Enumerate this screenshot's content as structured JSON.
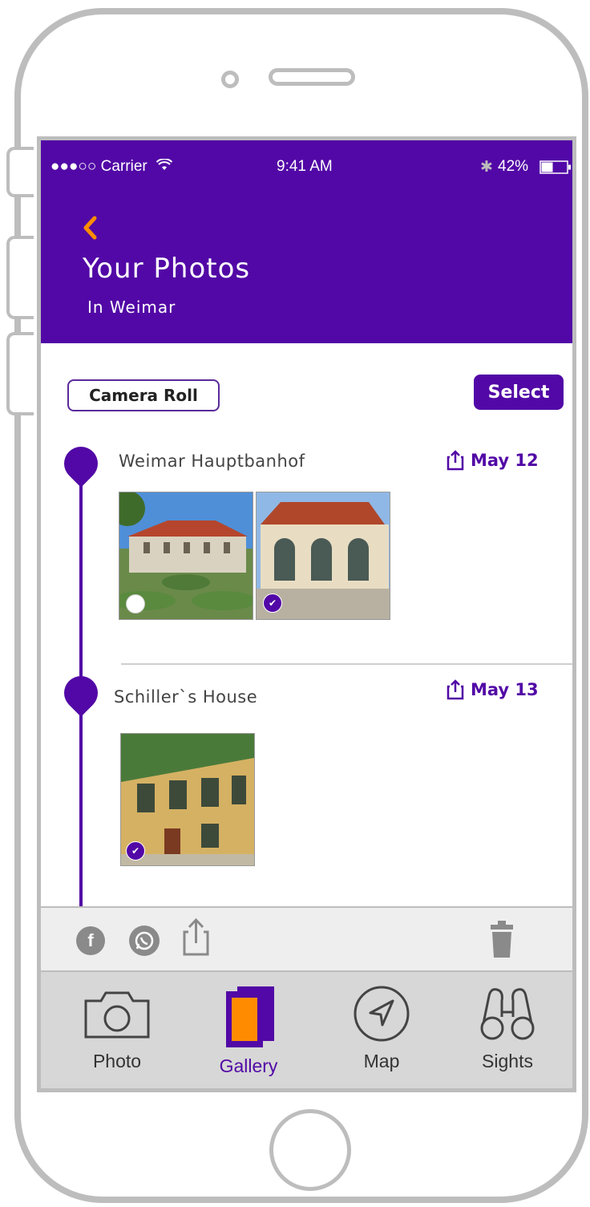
{
  "status_bar": {
    "carrier": "●●●○○ Carrier",
    "time": "9:41 AM",
    "battery": "42%"
  },
  "header": {
    "back_icon": "chevron-left-icon",
    "title": "Your Photos",
    "subtitle": "In Weimar"
  },
  "toolbar": {
    "camera_roll": "Camera Roll",
    "select": "Select"
  },
  "timeline": [
    {
      "location": "Weimar Hauptbanhof",
      "date": "May 12",
      "photos": [
        {
          "selected": false
        },
        {
          "selected": true
        }
      ]
    },
    {
      "location": "Schiller`s House",
      "date": "May 13",
      "photos": [
        {
          "selected": true
        }
      ]
    }
  ],
  "action_bar": {
    "icons": [
      "facebook-icon",
      "whatsapp-icon",
      "share-icon",
      "trash-icon"
    ]
  },
  "tabs": [
    {
      "label": "Photo",
      "icon": "camera-icon",
      "active": false
    },
    {
      "label": "Gallery",
      "icon": "gallery-icon",
      "active": true
    },
    {
      "label": "Map",
      "icon": "navigation-icon",
      "active": false
    },
    {
      "label": "Sights",
      "icon": "binoculars-icon",
      "active": false
    }
  ],
  "colors": {
    "accent": "#5208a6",
    "highlight": "#ff8c00"
  }
}
